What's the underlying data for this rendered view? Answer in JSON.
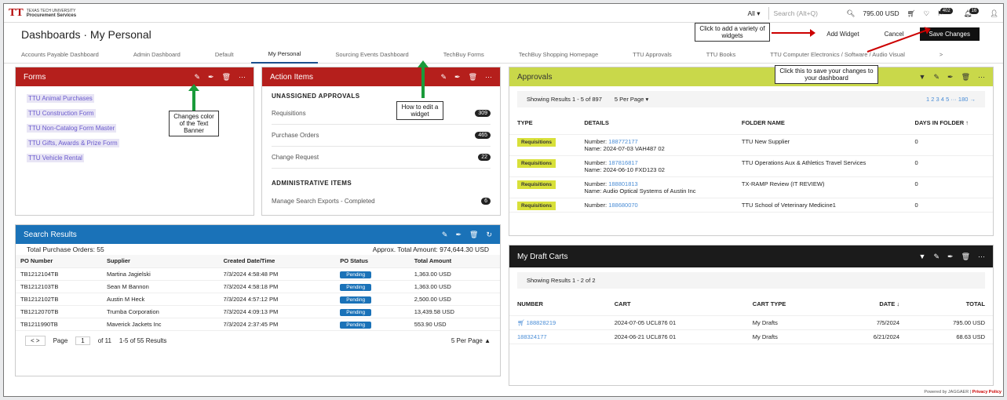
{
  "app": {
    "logo_mark": "TT",
    "logo_line1": "TEXAS TECH UNIVERSITY",
    "logo_line2": "Procurement Services"
  },
  "topbar": {
    "scope": "All ▾",
    "search_placeholder": "Search (Alt+Q)",
    "cart_total": "795.00 USD",
    "badge1": "402",
    "badge2": "16"
  },
  "header": {
    "title": "Dashboards · My Personal",
    "add_widget": "Add Widget",
    "cancel": "Cancel",
    "save": "Save Changes"
  },
  "tabs": [
    "Accounts Payable Dashboard",
    "Admin Dashboard",
    "Default",
    "My Personal",
    "Sourcing Events Dashboard",
    "TechBuy Forms",
    "TechBuy Shopping Homepage",
    "TTU Approvals",
    "TTU Books",
    "TTU Computer Electronics / Software / Audio Visual"
  ],
  "forms": {
    "title": "Forms",
    "items": [
      "TTU Animal Purchases",
      "TTU Construction Form",
      "TTU Non-Catalog Form Master",
      "TTU Gifts, Awards & Prize Form",
      "TTU Vehicle Rental"
    ]
  },
  "action": {
    "title": "Action Items",
    "sec1": "UNASSIGNED APPROVALS",
    "rows": [
      {
        "label": "Requisitions",
        "count": "309"
      },
      {
        "label": "Purchase Orders",
        "count": "465"
      },
      {
        "label": "Change Request",
        "count": "22"
      }
    ],
    "sec2": "ADMINISTRATIVE ITEMS",
    "admin_row": {
      "label": "Manage Search Exports - Completed",
      "count": "6"
    }
  },
  "search": {
    "title": "Search Results",
    "total": "Total Purchase Orders: 55",
    "amount": "Approx. Total Amount: 974,644.30 USD",
    "cols": [
      "PO Number",
      "Supplier",
      "Created Date/Time",
      "PO Status",
      "Total Amount"
    ],
    "rows": [
      [
        "TB1212104TB",
        "Martina Jagielski",
        "7/3/2024 4:58:48 PM",
        "Pending",
        "1,363.00 USD"
      ],
      [
        "TB1212103TB",
        "Sean M Bannon",
        "7/3/2024 4:58:18 PM",
        "Pending",
        "1,363.00 USD"
      ],
      [
        "TB1212102TB",
        "Austin M Heck",
        "7/3/2024 4:57:12 PM",
        "Pending",
        "2,500.00 USD"
      ],
      [
        "TB1212070TB",
        "Trumba Corporation",
        "7/3/2024 4:09:13 PM",
        "Pending",
        "13,439.58 USD"
      ],
      [
        "TB1211990TB",
        "Maverick Jackets Inc",
        "7/3/2024 2:37:45 PM",
        "Pending",
        "553.90 USD"
      ]
    ],
    "page_label": "Page",
    "page_value": "1",
    "of_pages": "of 11",
    "results": "1-5 of 55 Results",
    "per_page": "5 Per Page ▲"
  },
  "approvals": {
    "title": "Approvals",
    "showing": "Showing Results 1 - 5 of 897",
    "per_page": "5 Per Page ▾",
    "pages": "1  2  3  4  5  ···  180  →",
    "cols": [
      "TYPE",
      "DETAILS",
      "FOLDER NAME",
      "DAYS IN FOLDER ↑"
    ],
    "rows": [
      {
        "type": "Requisitions",
        "number": "188772177",
        "name": "Name: 2024-07-03 VAH487 02",
        "folder": "TTU New Supplier",
        "days": "0"
      },
      {
        "type": "Requisitions",
        "number": "187816817",
        "name": "Name: 2024-06-10 FXD123 02",
        "folder": "TTU Operations Aux & Athletics Travel Services",
        "days": "0"
      },
      {
        "type": "Requisitions",
        "number": "188801813",
        "name": "Name: Audio Optical Systems of Austin Inc",
        "folder": "TX-RAMP Review (IT REVIEW)",
        "days": "0"
      },
      {
        "type": "Requisitions",
        "number": "188680070",
        "name": "",
        "folder": "TTU School of Veterinary Medicine1",
        "days": "0"
      }
    ],
    "number_label": "Number: "
  },
  "drafts": {
    "title": "My Draft Carts",
    "showing": "Showing Results 1 - 2 of 2",
    "cols": [
      "NUMBER",
      "CART",
      "CART TYPE",
      "DATE ↓",
      "TOTAL"
    ],
    "rows": [
      [
        "188828219",
        "2024-07-05 UCL876 01",
        "My Drafts",
        "7/5/2024",
        "795.00 USD"
      ],
      [
        "188324177",
        "2024-06-21 UCL876 01",
        "My Drafts",
        "6/21/2024",
        "68.63 USD"
      ]
    ]
  },
  "callouts": {
    "widgets": "Click to add a variety of widgets",
    "save": "Click this to save your changes to your dashboard",
    "edit": "How to edit a widget",
    "color": "Changes color of the Text Banner"
  },
  "footer": {
    "powered": "Powered by JAGGAER | ",
    "privacy": "Privacy Policy"
  }
}
